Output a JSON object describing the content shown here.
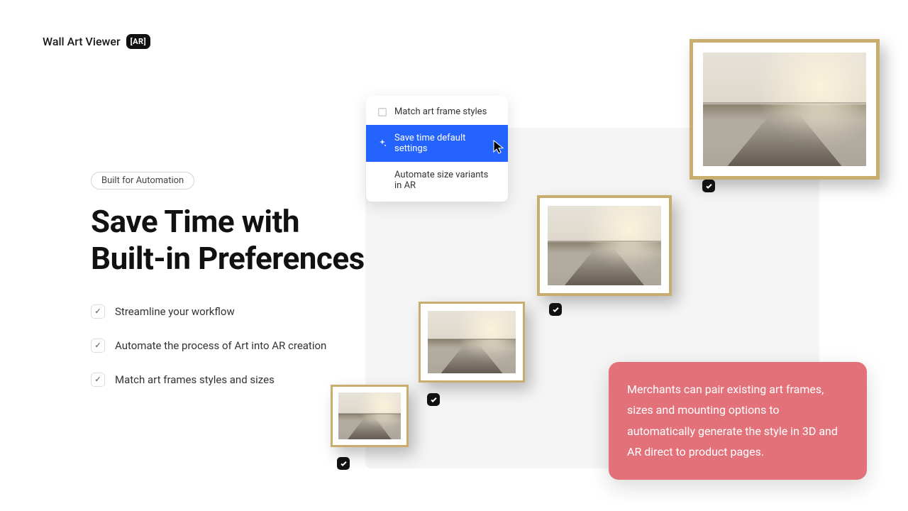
{
  "logo": {
    "text": "Wall Art Viewer",
    "badge": "[AR]"
  },
  "hero": {
    "pill": "Built for Automation",
    "heading_line1": "Save Time with",
    "heading_line2": "Built-in Preferences",
    "bullets": [
      "Streamline your workflow",
      "Automate the process of Art into AR creation",
      "Match art frames styles and sizes"
    ]
  },
  "menu": {
    "items": [
      {
        "label": "Match art frame styles",
        "active": false
      },
      {
        "label": "Save time default settings",
        "active": true
      },
      {
        "label": "Automate size variants in AR",
        "active": false
      }
    ]
  },
  "callout": "Merchants can pair existing art frames, sizes and mounting options to automatically generate the style in 3D and AR direct to product pages.",
  "colors": {
    "accent": "#2563ff",
    "callout": "#e27179",
    "frame": "#c9ad6e"
  }
}
